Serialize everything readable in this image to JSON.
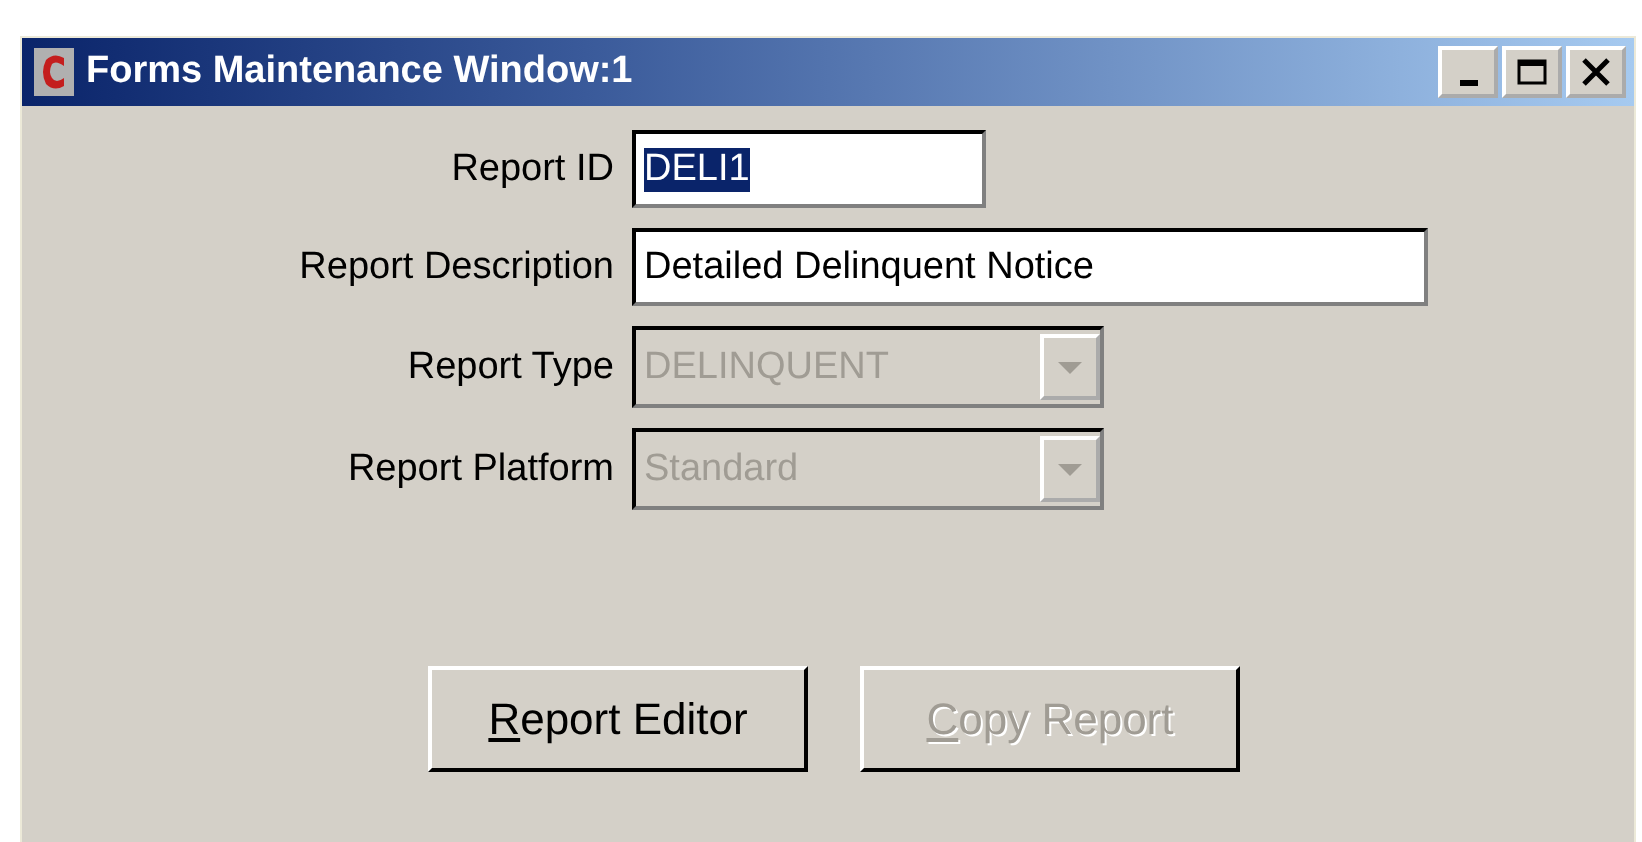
{
  "window": {
    "title": "Forms Maintenance Window:1",
    "controls": [
      {
        "kind": "minimize"
      },
      {
        "kind": "maximize"
      },
      {
        "kind": "close"
      }
    ]
  },
  "fields": [
    {
      "label": "Report ID",
      "kind": "short_text",
      "value": "DELI1",
      "value_selected": true,
      "disabled": false
    },
    {
      "label": "Report Description",
      "kind": "long_text",
      "value": "Detailed Delinquent Notice",
      "value_selected": false,
      "disabled": false
    },
    {
      "label": "Report Type",
      "kind": "combo",
      "value": "DELINQUENT",
      "disabled": true
    },
    {
      "label": "Report Platform",
      "kind": "combo",
      "value": "Standard",
      "disabled": true
    }
  ],
  "buttons": [
    {
      "mnemonic": "R",
      "rest": "eport Editor",
      "disabled": false
    },
    {
      "mnemonic": "C",
      "rest": "opy Report",
      "disabled": true
    }
  ]
}
